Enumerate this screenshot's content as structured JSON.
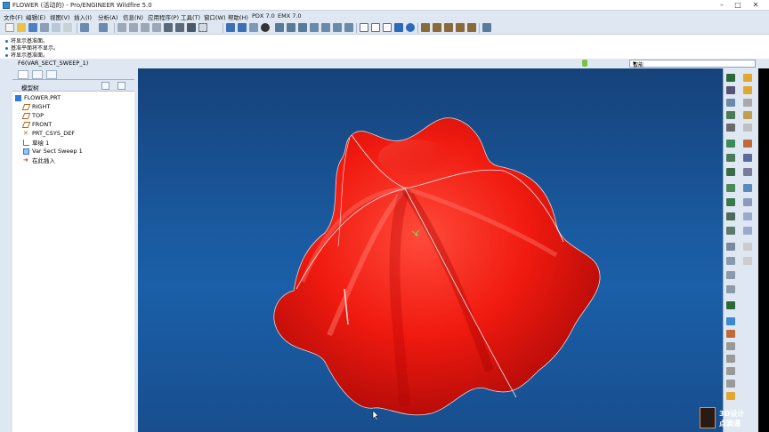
{
  "window": {
    "title": "FLOWER (活动的) - Pro/ENGINEER Wildfire 5.0"
  },
  "menu": {
    "items": [
      "文件(F)",
      "编辑(E)",
      "视图(V)",
      "插入(I)",
      "分析(A)",
      "信息(N)",
      "应用程序(P)",
      "工具(T)",
      "窗口(W)",
      "帮助(H)",
      "PDX 7.0",
      "EMX 7.0"
    ]
  },
  "messages": {
    "lines": [
      "将显示基准面。",
      "基准平面将不显示。",
      "将显示基准面。"
    ]
  },
  "status": {
    "current_feature": "F6(VAR_SECT_SWEEP_1)",
    "filter_value": "智能"
  },
  "model_tree": {
    "header": "模型树",
    "nodes": [
      {
        "label": "FLOWER.PRT",
        "icon": "part-icon",
        "color": "#2b7cd3"
      },
      {
        "label": "RIGHT",
        "icon": "datum-plane-icon",
        "color": "#b0671a"
      },
      {
        "label": "TOP",
        "icon": "datum-plane-icon",
        "color": "#b0671a"
      },
      {
        "label": "FRONT",
        "icon": "datum-plane-icon",
        "color": "#b0671a"
      },
      {
        "label": "PRT_CSYS_DEF",
        "icon": "csys-icon",
        "color": "#b0671a"
      },
      {
        "label": "草绘 1",
        "icon": "sketch-icon",
        "color": "#2b7cd3"
      },
      {
        "label": "Var Sect Sweep 1",
        "icon": "sweep-icon",
        "color": "#2b7cd3"
      },
      {
        "label": "在此插入",
        "icon": "insert-here-icon",
        "color": "#c0281c"
      }
    ]
  },
  "viewport": {
    "background_top": "#16427a",
    "background_bottom": "#1a5fa8",
    "model_color": "#f01a10"
  },
  "watermark": {
    "line1": "3D设计",
    "line2": "点滴通"
  }
}
